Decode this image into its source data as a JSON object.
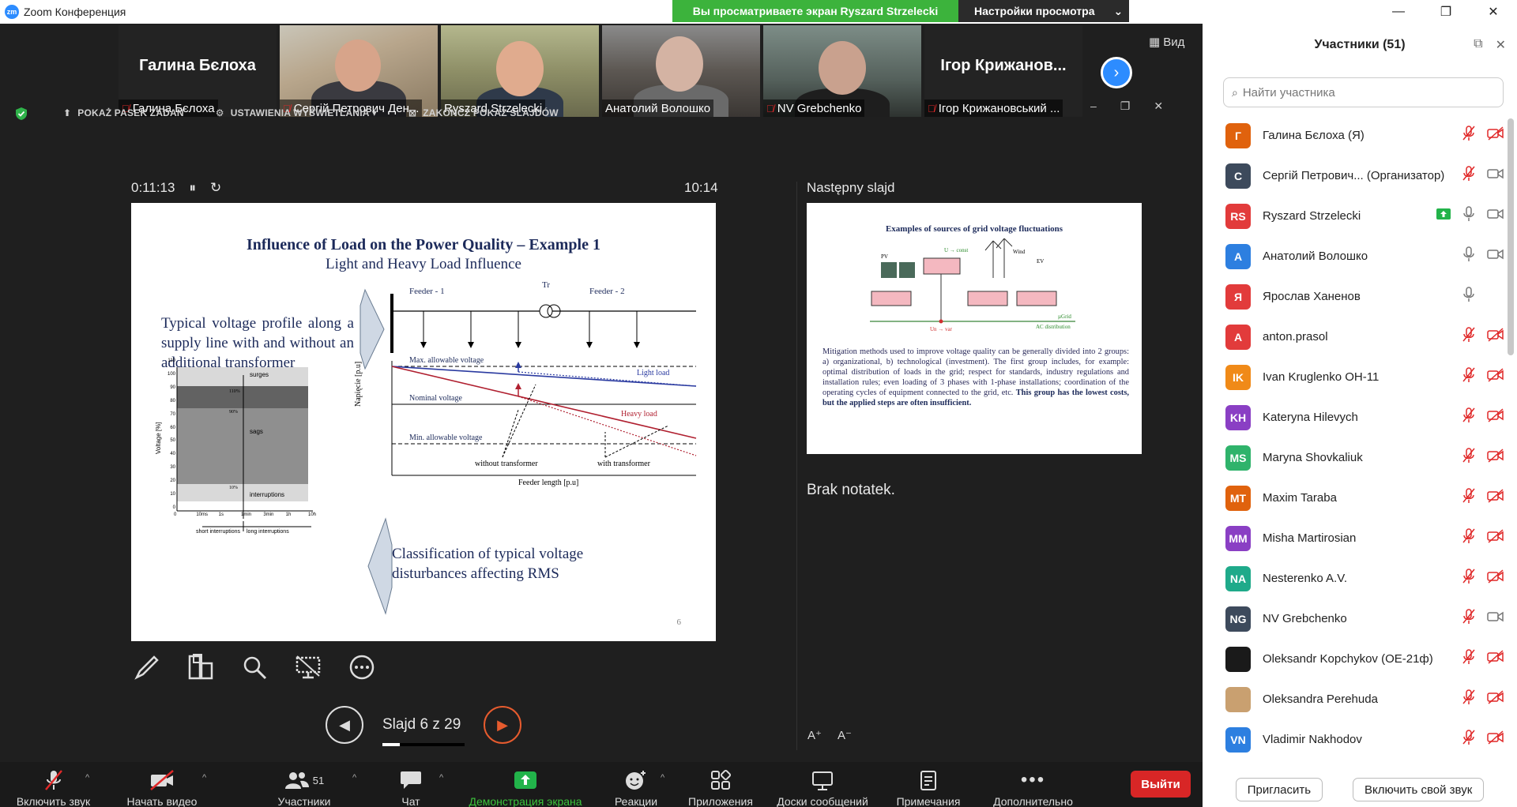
{
  "window": {
    "title": "Zoom Конференция",
    "logo_text": "zm"
  },
  "share_banner": {
    "viewing": "Вы просматриваете экран Ryszard Strzelecki",
    "settings": "Настройки просмотра"
  },
  "video_strip": {
    "view_label": "Вид",
    "tiles": [
      {
        "big_name": "Галина Бєлоха",
        "label": "Галина Бєлоха",
        "muted": true
      },
      {
        "big_name": "",
        "label": "Сергій Петрович Ден...",
        "muted": true
      },
      {
        "big_name": "",
        "label": "Ryszard Strzelecki",
        "muted": false
      },
      {
        "big_name": "",
        "label": "Анатолий Волошко",
        "muted": false
      },
      {
        "big_name": "",
        "label": "NV Grebchenko",
        "muted": true
      },
      {
        "big_name": "Ігор Крижанов...",
        "label": "Ігор Крижановський ...",
        "muted": true
      }
    ]
  },
  "slideshow_toolbar": {
    "show_taskbar": "POKAŻ PASEK ZADAŃ",
    "display_settings": "USTAWIENIA WYŚWIETLANIA ▾",
    "end_show": "ZAKOŃCZ POKAZ SLAJDÓW"
  },
  "presenter": {
    "elapsed": "0:11:13",
    "clock": "10:14",
    "next_label": "Następny slajd",
    "notes": "Brak notatek.",
    "slide_counter": "Slajd 6 z 29",
    "progress": 0.2069
  },
  "current_slide": {
    "title": "Influence of Load on the Power Quality – Example 1",
    "subtitle": "Light and Heavy Load Influence",
    "left_text": "Typical voltage profile along a supply line with and without an additional transformer",
    "bottom_text": "Classification of typical voltage disturbances affecting RMS",
    "page_number": "6",
    "diagram": {
      "feeder1": "Feeder - 1",
      "tr": "Tr",
      "feeder2": "Feeder - 2",
      "max_voltage": "Max. allowable voltage",
      "nominal_voltage": "Nominal voltage",
      "min_voltage": "Min. allowable voltage",
      "light_load": "Light load",
      "heavy_load": "Heavy load",
      "without_tr": "without transformer",
      "with_tr": "with transformer",
      "y_axis": "Napięcie [p.u]",
      "x_axis": "Feeder length [p.u]"
    },
    "chart": {
      "y_label": "Voltage [%]",
      "surges": "surges",
      "sags": "sags",
      "interruptions": "interruptions",
      "p110": "110%",
      "p90": "90%",
      "p10": "10%",
      "y_ticks": [
        "110",
        "100",
        "90",
        "80",
        "70",
        "60",
        "50",
        "40",
        "30",
        "20",
        "10",
        "0"
      ],
      "x_ticks": [
        "0",
        "10ms",
        "1s",
        "1min",
        "3min",
        "1h",
        "10h"
      ],
      "short_int": "short interruptions",
      "long_int": "long interruptions"
    }
  },
  "next_slide": {
    "title": "Examples of sources of grid voltage fluctuations",
    "labels": {
      "pv": "PV",
      "wind": "Wind",
      "ev": "EV",
      "u_const": "U → const",
      "ugrid": "µGrid",
      "ac": "AC distribution",
      "un": "Un → var"
    },
    "body_plain": "Mitigation methods used to improve voltage quality can be generally divided into 2 groups: a) organizational, b) technological (investment). The first group includes, for example: optimal distribution of loads in the grid; respect for standards, industry regulations and installation rules; even loading of 3 phases with 1-phase installations; coordination of the operating cycles of equipment connected to the grid, etc. ",
    "body_bold": "This group has the lowest costs, but the applied steps are often insufficient."
  },
  "bottom_bar": {
    "unmute": "Включить звук",
    "start_video": "Начать видео",
    "participants": "Участники",
    "participants_count": "51",
    "chat": "Чат",
    "share": "Демонстрация экрана",
    "reactions": "Реакции",
    "apps": "Приложения",
    "whiteboards": "Доски сообщений",
    "notes": "Примечания",
    "more": "Дополнительно",
    "leave": "Выйти"
  },
  "participants_panel": {
    "title": "Участники (51)",
    "search_placeholder": "Найти участника",
    "invite": "Пригласить",
    "unmute_me": "Включить свой звук",
    "participants": [
      {
        "initials": "Г",
        "name": "Галина Бєлоха (Я)",
        "color": "#e0620d",
        "mic": "off",
        "video": "off",
        "sharing": false
      },
      {
        "initials": "С",
        "name": "Сергій Петрович... (Организатор)",
        "color": "#3d4a5c",
        "mic": "off",
        "video": "on",
        "sharing": false
      },
      {
        "initials": "RS",
        "name": "Ryszard Strzelecki",
        "color": "#e23b3b",
        "mic": "on",
        "video": "on",
        "sharing": true
      },
      {
        "initials": "А",
        "name": "Анатолий Волошко",
        "color": "#2d7fe0",
        "mic": "on",
        "video": "on",
        "sharing": false
      },
      {
        "initials": "Я",
        "name": "Ярослав Ханенов",
        "color": "#e23b3b",
        "mic": "on",
        "video": "none",
        "sharing": false
      },
      {
        "initials": "A",
        "name": "anton.prasol",
        "color": "#e23b3b",
        "mic": "off",
        "video": "off",
        "sharing": false
      },
      {
        "initials": "IK",
        "name": "Ivan Kruglenko ОН-11",
        "color": "#f08a18",
        "mic": "off",
        "video": "off",
        "sharing": false
      },
      {
        "initials": "KH",
        "name": "Kateryna Hilevych",
        "color": "#8a3fc4",
        "mic": "off",
        "video": "off",
        "sharing": false
      },
      {
        "initials": "MS",
        "name": "Maryna Shovkaliuk",
        "color": "#2fb36b",
        "mic": "off",
        "video": "off",
        "sharing": false
      },
      {
        "initials": "MT",
        "name": "Maxim Taraba",
        "color": "#e0620d",
        "mic": "off",
        "video": "off",
        "sharing": false
      },
      {
        "initials": "MM",
        "name": "Misha Martirosian",
        "color": "#8a3fc4",
        "mic": "off",
        "video": "off",
        "sharing": false
      },
      {
        "initials": "NA",
        "name": "Nesterenko A.V.",
        "color": "#1faa8a",
        "mic": "off",
        "video": "off",
        "sharing": false
      },
      {
        "initials": "NG",
        "name": "NV Grebchenko",
        "color": "#3d4a5c",
        "mic": "off",
        "video": "on",
        "sharing": false
      },
      {
        "initials": "",
        "name": "Oleksandr Kopchykov (OE-21ф)",
        "color": "#1a1a1a",
        "mic": "off",
        "video": "off",
        "sharing": false
      },
      {
        "initials": "",
        "name": "Oleksandra Perehuda",
        "color": "#c9a070",
        "mic": "off",
        "video": "off",
        "sharing": false
      },
      {
        "initials": "VN",
        "name": "Vladimir Nakhodov",
        "color": "#2d7fe0",
        "mic": "off",
        "video": "off",
        "sharing": false
      }
    ]
  }
}
